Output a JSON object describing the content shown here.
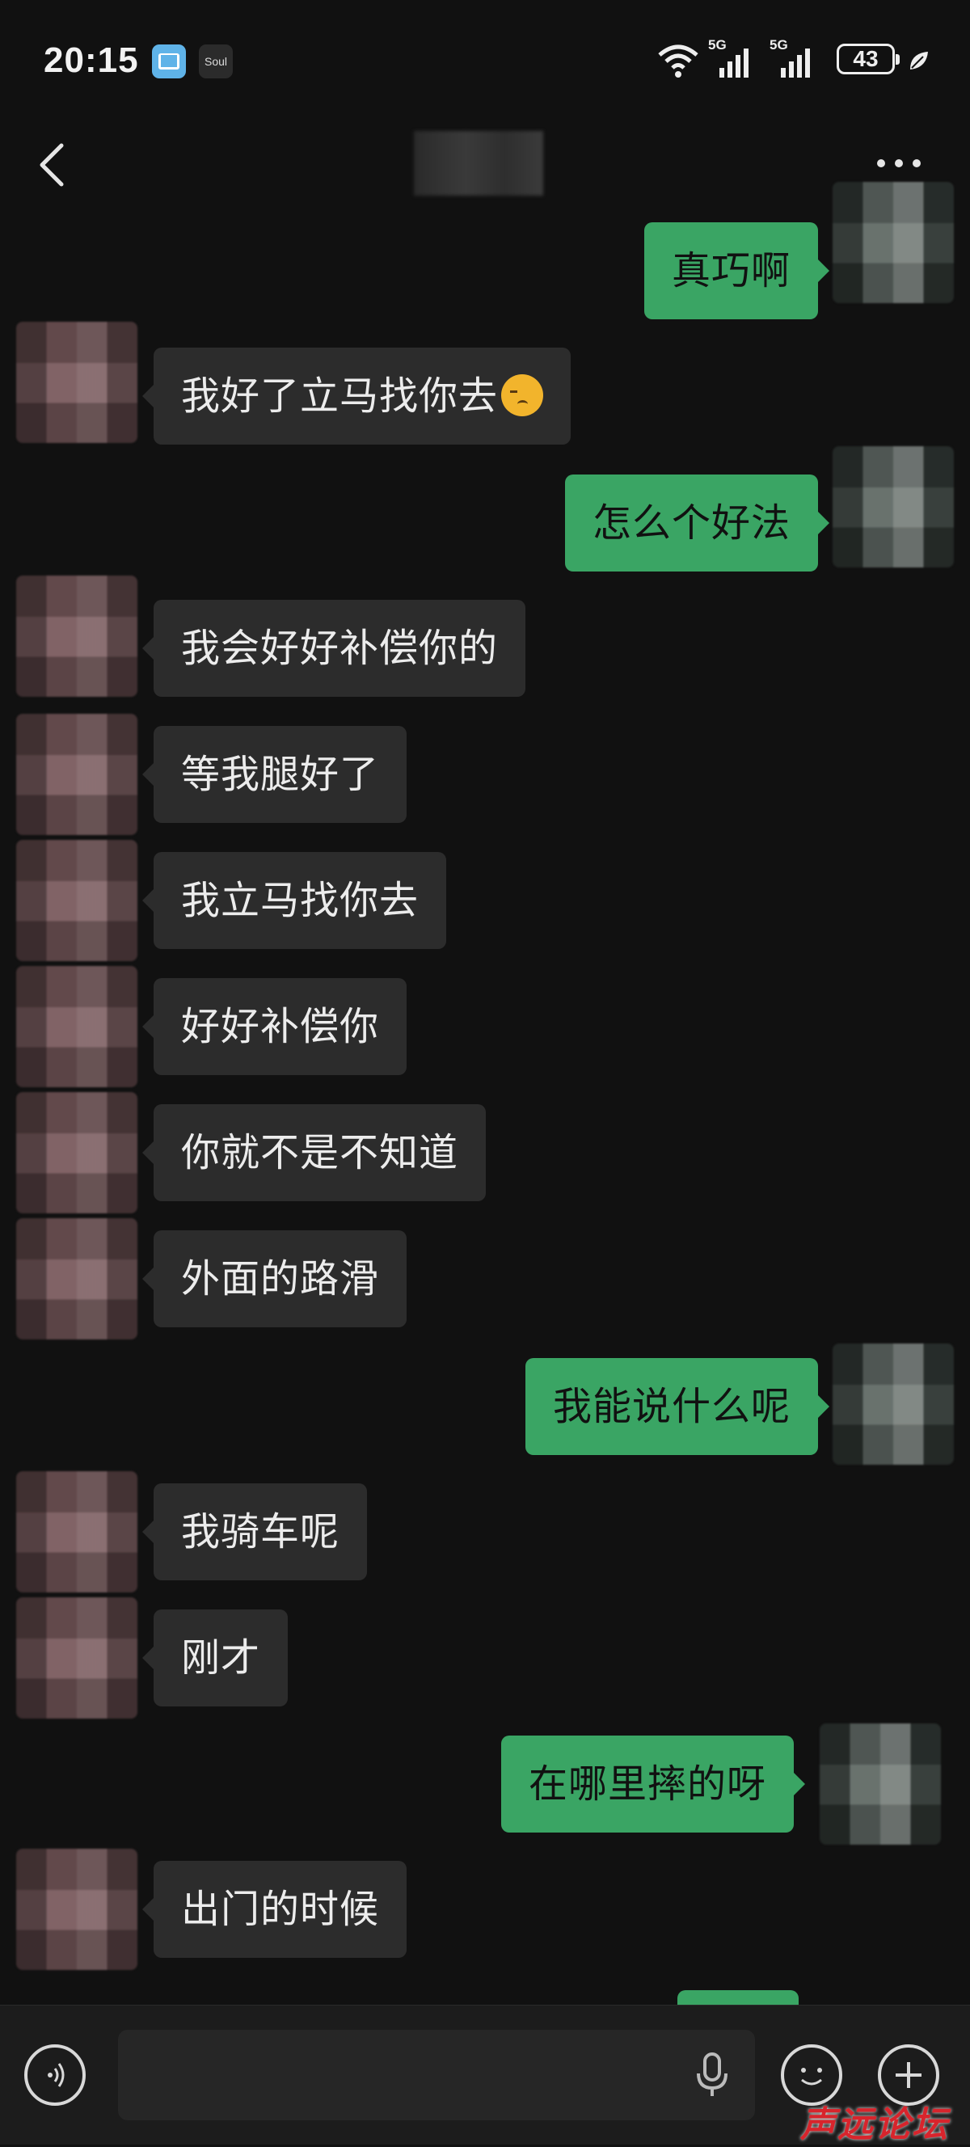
{
  "status_bar": {
    "time": "20:15",
    "app_icons": [
      "book-icon",
      "soul-icon"
    ],
    "soul_label": "Soul",
    "network_1": "5G",
    "network_2": "5G",
    "battery": "43"
  },
  "header": {
    "back_icon": "chevron-left-icon",
    "more_icon": "more-dots-icon"
  },
  "messages": [
    {
      "side": "out",
      "text": "真巧啊"
    },
    {
      "side": "in",
      "text": "我好了立马找你去",
      "emoji": "tired-face-emoji"
    },
    {
      "side": "out",
      "text": "怎么个好法"
    },
    {
      "side": "in",
      "text": "我会好好补偿你的"
    },
    {
      "side": "in",
      "text": "等我腿好了"
    },
    {
      "side": "in",
      "text": "我立马找你去"
    },
    {
      "side": "in",
      "text": "好好补偿你"
    },
    {
      "side": "in",
      "text": "你就不是不知道"
    },
    {
      "side": "in",
      "text": "外面的路滑"
    },
    {
      "side": "out",
      "text": "我能说什么呢"
    },
    {
      "side": "in",
      "text": "我骑车呢"
    },
    {
      "side": "in",
      "text": "刚才"
    },
    {
      "side": "out",
      "text": "在哪里摔的呀"
    },
    {
      "side": "in",
      "text": "出门的时候"
    }
  ],
  "input_bar": {
    "placeholder": "",
    "value": ""
  },
  "watermark": "声远论坛",
  "colors": {
    "background": "#111111",
    "incoming_bubble": "#2c2c2c",
    "outgoing_bubble": "#3aa564",
    "watermark": "#d8242c"
  }
}
